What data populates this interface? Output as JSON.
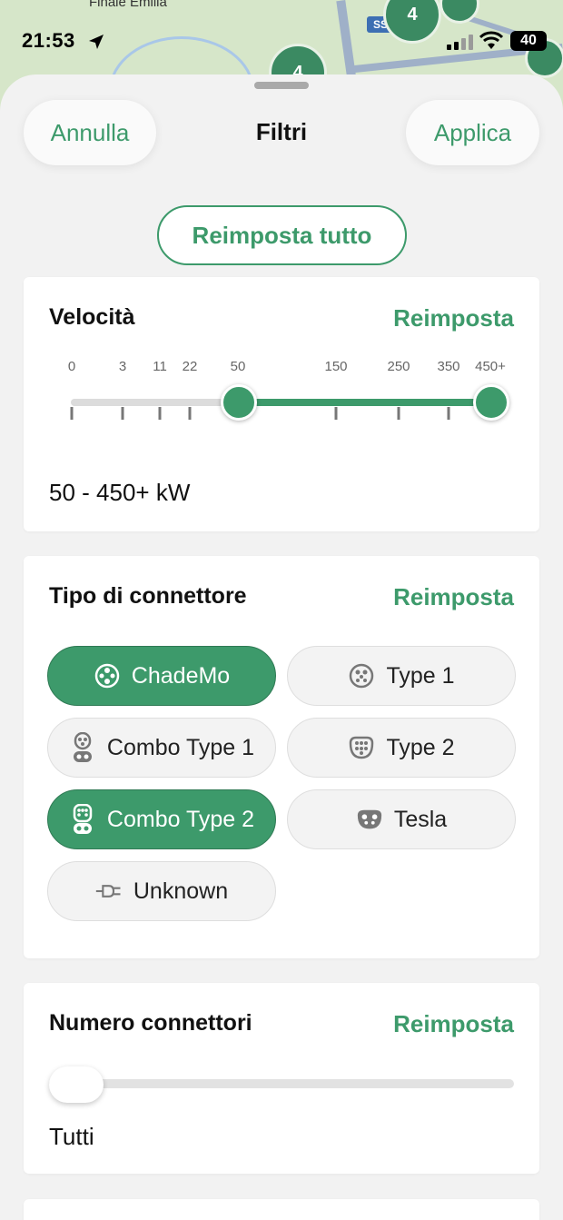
{
  "map": {
    "place_label": "Finale Emilia",
    "clusters": [
      "4",
      "4"
    ],
    "road_shield": "SS"
  },
  "status_bar": {
    "time": "21:53",
    "battery": "40"
  },
  "header": {
    "cancel_label": "Annulla",
    "title": "Filtri",
    "apply_label": "Applica"
  },
  "reset_all_label": "Reimposta tutto",
  "speed": {
    "title": "Velocità",
    "reset_label": "Reimposta",
    "ticks": [
      "0",
      "3",
      "11",
      "22",
      "50",
      "150",
      "250",
      "350",
      "450+"
    ],
    "range_min": "50",
    "range_max": "450+",
    "range_text": "50 - 450+ kW"
  },
  "connectors": {
    "title": "Tipo di connettore",
    "reset_label": "Reimposta",
    "items": [
      {
        "label": "ChadeMo",
        "selected": true,
        "icon": "chademo-icon"
      },
      {
        "label": "Type 1",
        "selected": false,
        "icon": "type1-icon"
      },
      {
        "label": "Combo Type 1",
        "selected": false,
        "icon": "combo-type1-icon"
      },
      {
        "label": "Type 2",
        "selected": false,
        "icon": "type2-icon"
      },
      {
        "label": "Combo Type 2",
        "selected": true,
        "icon": "combo-type2-icon"
      },
      {
        "label": "Tesla",
        "selected": false,
        "icon": "tesla-icon"
      },
      {
        "label": "Unknown",
        "selected": false,
        "icon": "plug-icon"
      }
    ]
  },
  "connector_count": {
    "title": "Numero connettori",
    "reset_label": "Reimposta",
    "value": "Tutti"
  },
  "colors": {
    "accent": "#3d9a6b",
    "sheet_bg": "#f2f2f2",
    "card_bg": "#ffffff"
  }
}
